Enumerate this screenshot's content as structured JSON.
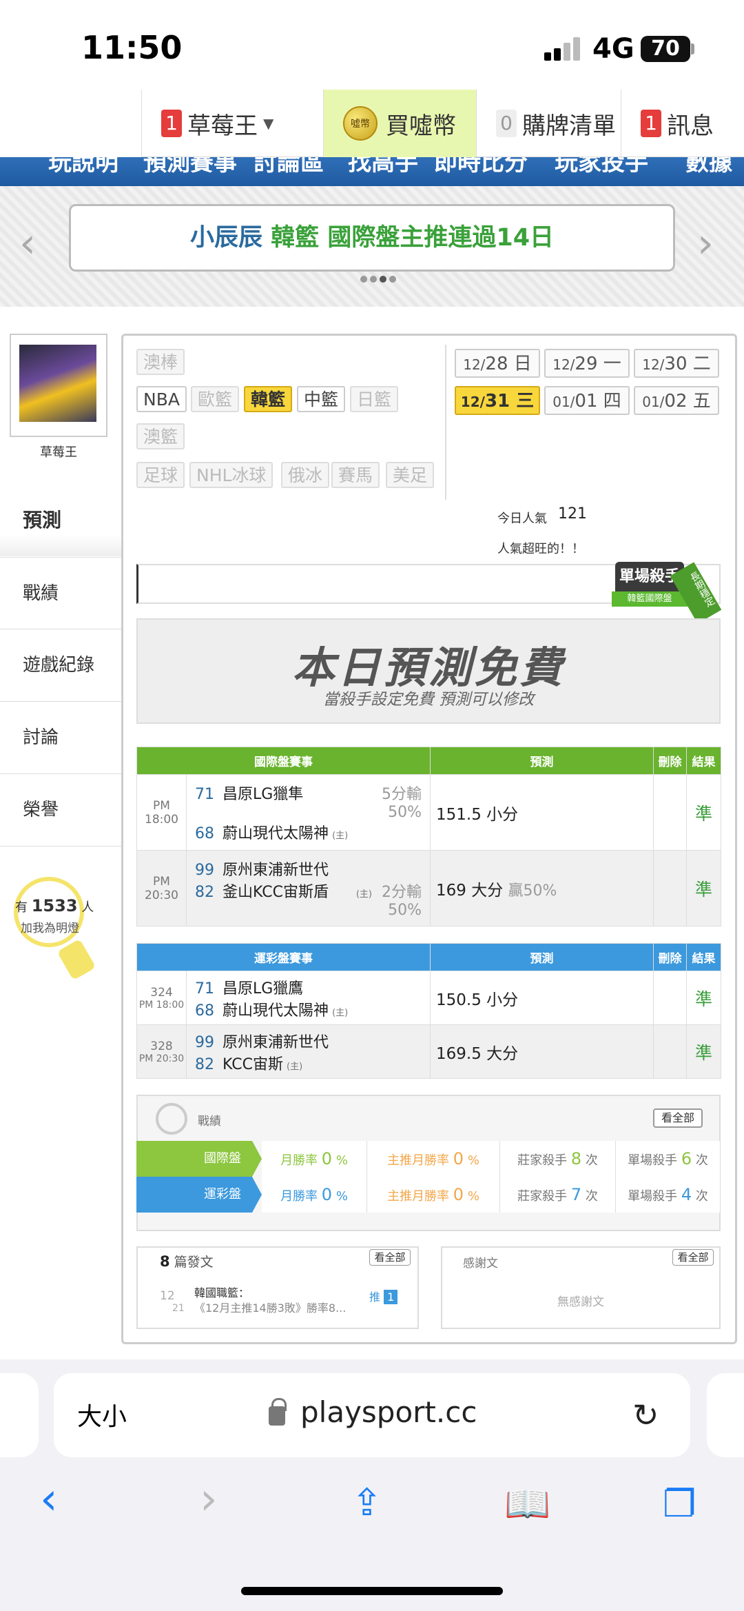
{
  "status": {
    "time": "11:50",
    "network": "4G",
    "battery": "70"
  },
  "topnav": {
    "user": {
      "badge": "1",
      "label": "草莓王"
    },
    "buy": {
      "label": "買噓幣",
      "coin": "噓幣"
    },
    "cart": {
      "badge": "0",
      "label": "購牌清單"
    },
    "msg": {
      "badge": "1",
      "label": "訊息"
    }
  },
  "mainmenu": [
    "玩說明",
    "預測賽事",
    "討論區",
    "找高手",
    "即時比分",
    "玩家投手",
    "數據"
  ],
  "banner": {
    "part1": "小辰辰",
    "part2": "韓籃",
    "part3": "國際盤主推連過14日"
  },
  "profile": {
    "name": "草莓王"
  },
  "sidebar": [
    "預測",
    "戰績",
    "遊戲紀錄",
    "討論",
    "榮譽"
  ],
  "fans": {
    "prefix": "有",
    "count": "1533",
    "suffix": "人",
    "sub": "加我為明燈"
  },
  "leagues": {
    "row1": [
      "澳棒"
    ],
    "row2": [
      "NBA",
      "歐籃",
      "韓籃",
      "中籃",
      "日籃"
    ],
    "row3": [
      "澳籃"
    ],
    "row4": [
      "足球",
      "NHL冰球",
      "俄冰",
      "賽馬",
      "美足"
    ]
  },
  "dates": [
    {
      "md": "12/",
      "d": "28",
      "w": "日"
    },
    {
      "md": "12/",
      "d": "29",
      "w": "一"
    },
    {
      "md": "12/",
      "d": "30",
      "w": "二"
    },
    {
      "md": "12/",
      "d": "31",
      "w": "三"
    },
    {
      "md": "01/",
      "d": "01",
      "w": "四"
    },
    {
      "md": "01/",
      "d": "02",
      "w": "五"
    }
  ],
  "popularity": {
    "label": "今日人氣",
    "value": "121",
    "sub": "人氣超旺的！！"
  },
  "killer": {
    "title": "單場殺手",
    "sub": "韓籃國際盤",
    "ribbon": "長期穩定"
  },
  "free": {
    "title": "本日預測免費",
    "sub": "當殺手設定免費  預測可以修改"
  },
  "intl": {
    "header": "國際盤賽事",
    "pred": "預測",
    "del": "刪除",
    "res": "結果",
    "games": [
      {
        "time": "PM 18:00",
        "s1": "71",
        "t1": "昌原LG獵隼",
        "hcp1": "5分輸",
        "hcp2": "50%",
        "s2": "68",
        "t2": "蔚山現代太陽神",
        "home": "(主)",
        "pred": "151.5 小分",
        "win": "",
        "res": "準"
      },
      {
        "time": "PM 20:30",
        "s1": "99",
        "t1": "原州東浦新世代",
        "hcp1": "2分輸",
        "hcp2": "50%",
        "s2": "82",
        "t2": "釜山KCC宙斯盾",
        "home": "(主)",
        "pred": "169 大分",
        "win": "贏50%",
        "res": "準"
      }
    ]
  },
  "lottery": {
    "header": "運彩盤賽事",
    "pred": "預測",
    "del": "刪除",
    "res": "結果",
    "games": [
      {
        "id": "324",
        "time": "PM 18:00",
        "s1": "71",
        "t1": "昌原LG獵鷹",
        "s2": "68",
        "t2": "蔚山現代太陽神",
        "home": "(主)",
        "pred": "150.5 小分",
        "res": "準"
      },
      {
        "id": "328",
        "time": "PM 20:30",
        "s1": "99",
        "t1": "原州東浦新世代",
        "s2": "82",
        "t2": "KCC宙斯",
        "home": "(主)",
        "pred": "169.5 大分",
        "res": "準"
      }
    ]
  },
  "record": {
    "title": "戰績",
    "see_all": "看全部",
    "rows": [
      {
        "label": "國際盤",
        "monthly": "月勝率",
        "mv": "0",
        "home": "主推月勝率",
        "hv": "0",
        "dealer": "莊家殺手",
        "dv": "8",
        "single": "單場殺手",
        "sv": "6",
        "pct": "%",
        "times": "次"
      },
      {
        "label": "運彩盤",
        "monthly": "月勝率",
        "mv": "0",
        "home": "主推月勝率",
        "hv": "0",
        "dealer": "莊家殺手",
        "dv": "7",
        "single": "單場殺手",
        "sv": "4",
        "pct": "%",
        "times": "次"
      }
    ]
  },
  "posts": {
    "count": "8",
    "label": "篇發文",
    "see_all": "看全部",
    "month": "12",
    "day": "21",
    "title": "韓國職籃：",
    "snippet": "《12月主推14勝3敗》勝率8...",
    "push": "推",
    "push_count": "1"
  },
  "thanks": {
    "label": "感謝文",
    "see_all": "看全部",
    "empty": "無感謝文"
  },
  "browser": {
    "aa": "大小",
    "url": "playsport.cc"
  }
}
